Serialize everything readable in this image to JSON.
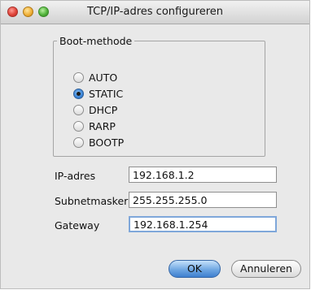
{
  "window": {
    "title": "TCP/IP-adres configureren"
  },
  "boot": {
    "legend": "Boot-methode",
    "options": [
      {
        "label": "AUTO",
        "selected": false
      },
      {
        "label": "STATIC",
        "selected": true
      },
      {
        "label": "DHCP",
        "selected": false
      },
      {
        "label": "RARP",
        "selected": false
      },
      {
        "label": "BOOTP",
        "selected": false
      }
    ]
  },
  "fields": {
    "ip": {
      "label": "IP-adres",
      "value": "192.168.1.2"
    },
    "subnet": {
      "label": "Subnetmasker",
      "value": "255.255.255.0"
    },
    "gateway": {
      "label": "Gateway",
      "value": "192.168.1.254"
    }
  },
  "buttons": {
    "ok": "OK",
    "cancel": "Annuleren"
  },
  "colors": {
    "accent": "#3e7fcf",
    "selected_radio": "#3a84d8",
    "focus_ring": "#7fa7da"
  }
}
